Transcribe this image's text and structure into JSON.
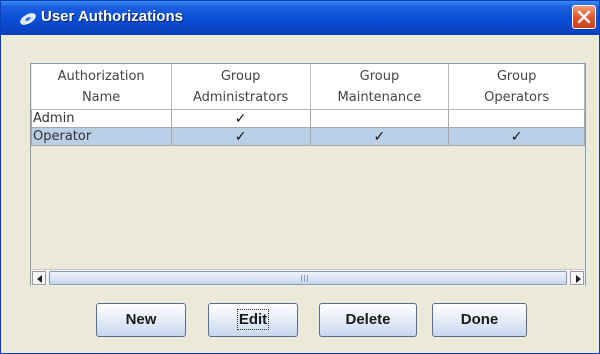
{
  "window": {
    "title": "User Authorizations",
    "title_color": "#ffffff",
    "titlebar_color": "#0b4fd6",
    "close_button_color": "#e0562d"
  },
  "table": {
    "columns": [
      {
        "line1": "Authorization",
        "line2": "Name"
      },
      {
        "line1": "Group",
        "line2": "Administrators"
      },
      {
        "line1": "Group",
        "line2": "Maintenance"
      },
      {
        "line1": "Group",
        "line2": "Operators"
      }
    ],
    "rows": [
      {
        "name": "Admin",
        "cells": [
          "✓",
          "",
          ""
        ],
        "selected": false
      },
      {
        "name": "Operator",
        "cells": [
          "✓",
          "✓",
          "✓"
        ],
        "selected": true
      }
    ],
    "selection_color": "#b8cfe5"
  },
  "buttons": {
    "new_label": "New",
    "edit_label": "Edit",
    "delete_label": "Delete",
    "done_label": "Done"
  }
}
